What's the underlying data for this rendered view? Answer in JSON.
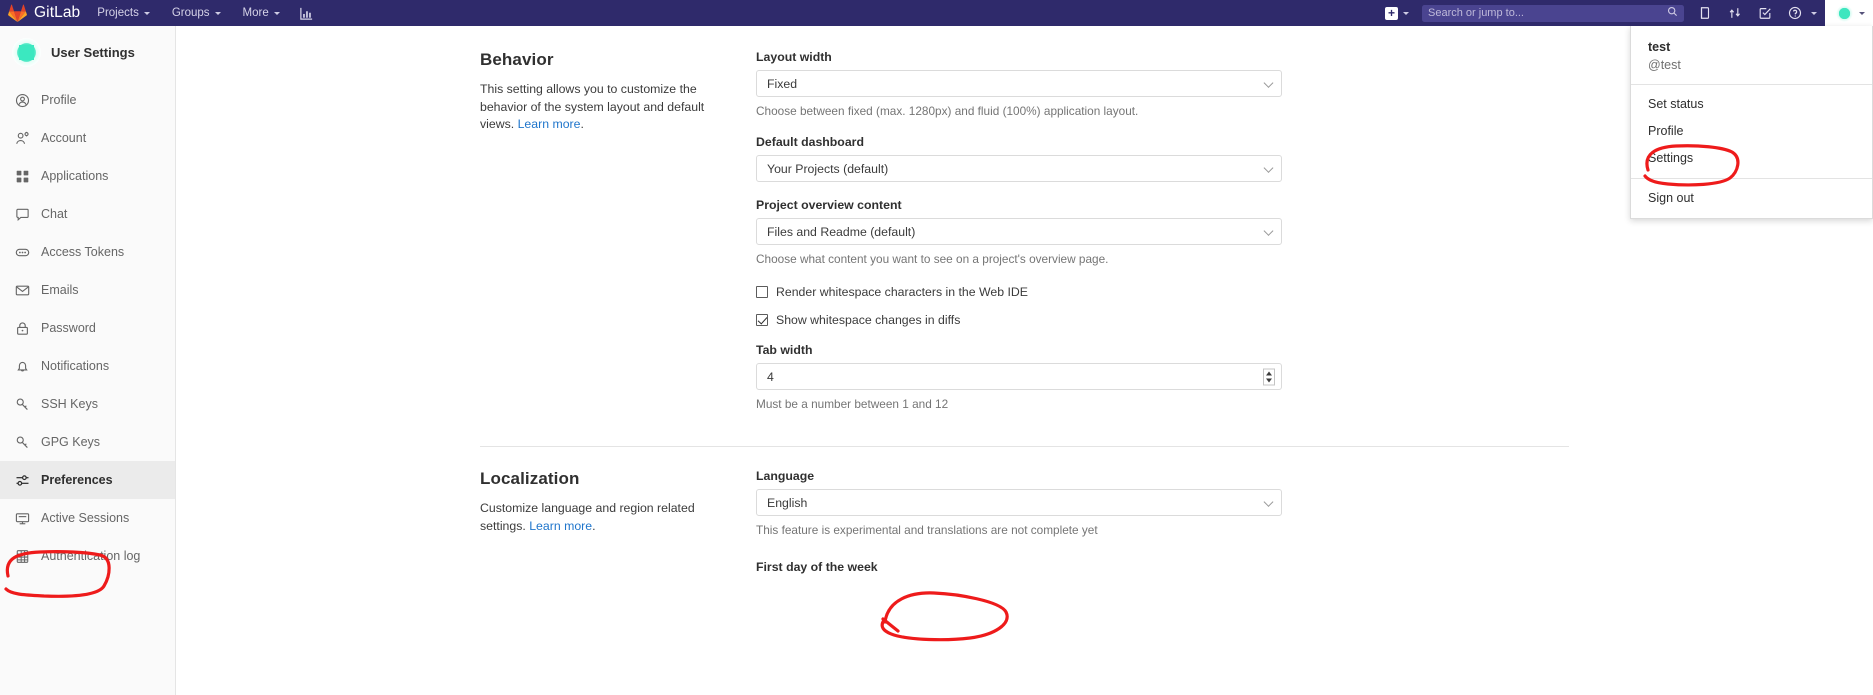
{
  "navbar": {
    "brand": "GitLab",
    "brand_icon": "gitlab-tanuki-logo",
    "items": [
      {
        "label": "Projects",
        "icon": "chevron-down-icon"
      },
      {
        "label": "Groups",
        "icon": "chevron-down-icon"
      },
      {
        "label": "More",
        "icon": "chevron-down-icon"
      }
    ],
    "analytics_icon": "analytics-chart-icon",
    "new_icon": "plus-square-icon",
    "search": {
      "placeholder": "Search or jump to...",
      "value": "",
      "icon": "search-icon"
    },
    "right_icons": [
      {
        "name": "issues-icon"
      },
      {
        "name": "merge-requests-icon"
      },
      {
        "name": "todos-icon"
      },
      {
        "name": "help-icon"
      }
    ],
    "avatar_icon": "user-avatar"
  },
  "user_dropdown": {
    "name": "test",
    "handle": "@test",
    "items": [
      {
        "label": "Set status"
      },
      {
        "label": "Profile"
      },
      {
        "label": "Settings"
      }
    ],
    "sign_out": "Sign out"
  },
  "sidebar": {
    "title": "User Settings",
    "avatar_icon": "user-avatar",
    "items": [
      {
        "label": "Profile",
        "icon": "user-circle-icon",
        "active": false
      },
      {
        "label": "Account",
        "icon": "user-gear-icon",
        "active": false
      },
      {
        "label": "Applications",
        "icon": "grid-squares-icon",
        "active": false
      },
      {
        "label": "Chat",
        "icon": "comment-icon",
        "active": false
      },
      {
        "label": "Access Tokens",
        "icon": "token-pill-icon",
        "active": false
      },
      {
        "label": "Emails",
        "icon": "envelope-icon",
        "active": false
      },
      {
        "label": "Password",
        "icon": "lock-icon",
        "active": false
      },
      {
        "label": "Notifications",
        "icon": "bell-icon",
        "active": false
      },
      {
        "label": "SSH Keys",
        "icon": "key-icon",
        "active": false
      },
      {
        "label": "GPG Keys",
        "icon": "key-icon",
        "active": false
      },
      {
        "label": "Preferences",
        "icon": "sliders-icon",
        "active": true
      },
      {
        "label": "Active Sessions",
        "icon": "monitor-icon",
        "active": false
      },
      {
        "label": "Authentication log",
        "icon": "log-table-icon",
        "active": false
      }
    ]
  },
  "behavior": {
    "title": "Behavior",
    "description": "This setting allows you to customize the behavior of the system layout and default views.",
    "learn_more": "Learn more",
    "fields": {
      "layout_width": {
        "label": "Layout width",
        "value": "Fixed",
        "helper": "Choose between fixed (max. 1280px) and fluid (100%) application layout."
      },
      "default_dashboard": {
        "label": "Default dashboard",
        "value": "Your Projects (default)"
      },
      "project_overview": {
        "label": "Project overview content",
        "value": "Files and Readme (default)",
        "helper": "Choose what content you want to see on a project's overview page."
      },
      "render_whitespace": {
        "label": "Render whitespace characters in the Web IDE",
        "checked": false
      },
      "show_whitespace_diffs": {
        "label": "Show whitespace changes in diffs",
        "checked": true
      },
      "tab_width": {
        "label": "Tab width",
        "value": "4",
        "helper": "Must be a number between 1 and 12"
      }
    }
  },
  "localization": {
    "title": "Localization",
    "description": "Customize language and region related settings.",
    "learn_more": "Learn more",
    "fields": {
      "language": {
        "label": "Language",
        "value": "English",
        "helper": "This feature is experimental and translations are not complete yet"
      },
      "first_day": {
        "label": "First day of the week"
      }
    }
  },
  "annotations": {
    "color": "#ee1b1b",
    "marks": [
      {
        "name": "preferences-sidebar-circle"
      },
      {
        "name": "settings-menu-circle"
      },
      {
        "name": "language-value-circle"
      }
    ]
  }
}
